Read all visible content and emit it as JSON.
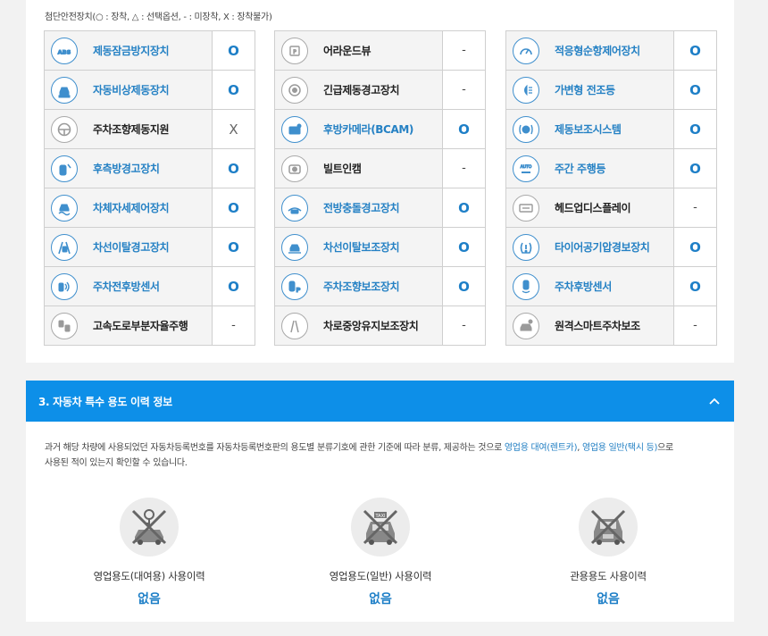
{
  "legend": "첨단안전장치(○ : 장착, △ : 선택옵션, - : 미장착, X : 장착불가)",
  "colors": {
    "accent": "#0d8fe8",
    "installed_text": "#2581c4",
    "icon_on": "#3f8fcd",
    "icon_off": "#a9a9a9"
  },
  "devices": [
    [
      {
        "name": "제동잠금방지장치",
        "status": "O",
        "icon": "abs-icon",
        "active": true
      },
      {
        "name": "자동비상제동장치",
        "status": "O",
        "icon": "emergency-brake-icon",
        "active": true
      },
      {
        "name": "주차조향제동지원",
        "status": "X",
        "icon": "steering-icon",
        "active": false
      },
      {
        "name": "후측방경고장치",
        "status": "O",
        "icon": "rear-side-warning-icon",
        "active": true
      },
      {
        "name": "차체자세제어장치",
        "status": "O",
        "icon": "stability-control-icon",
        "active": true
      },
      {
        "name": "차선이탈경고장치",
        "status": "O",
        "icon": "lane-departure-icon",
        "active": true
      },
      {
        "name": "주차전후방센서",
        "status": "O",
        "icon": "parking-sensor-icon",
        "active": true
      },
      {
        "name": "고속도로부분자율주행",
        "status": "-",
        "icon": "highway-assist-icon",
        "active": false
      }
    ],
    [
      {
        "name": "어라운드뷰",
        "status": "-",
        "icon": "around-view-icon",
        "active": false
      },
      {
        "name": "긴급제동경고장치",
        "status": "-",
        "icon": "brake-warning-icon",
        "active": false
      },
      {
        "name": "후방카메라(BCAM)",
        "status": "O",
        "icon": "rear-camera-icon",
        "active": true
      },
      {
        "name": "빌트인캠",
        "status": "-",
        "icon": "builtin-cam-icon",
        "active": false
      },
      {
        "name": "전방충돌경고장치",
        "status": "O",
        "icon": "forward-collision-icon",
        "active": true
      },
      {
        "name": "차선이탈보조장치",
        "status": "O",
        "icon": "lane-keep-assist-icon",
        "active": true
      },
      {
        "name": "주차조향보조장치",
        "status": "O",
        "icon": "parking-assist-icon",
        "active": true
      },
      {
        "name": "차로중앙유지보조장치",
        "status": "-",
        "icon": "lane-center-icon",
        "active": false
      }
    ],
    [
      {
        "name": "적응형순항제어장치",
        "status": "O",
        "icon": "adaptive-cruise-icon",
        "active": true
      },
      {
        "name": "가변형 전조등",
        "status": "O",
        "icon": "adaptive-headlamp-icon",
        "active": true
      },
      {
        "name": "제동보조시스템",
        "status": "O",
        "icon": "brake-assist-icon",
        "active": true
      },
      {
        "name": "주간 주행등",
        "status": "O",
        "icon": "drl-icon",
        "active": true
      },
      {
        "name": "헤드업디스플레이",
        "status": "-",
        "icon": "hud-icon",
        "active": false
      },
      {
        "name": "타이어공기압경보장치",
        "status": "O",
        "icon": "tpms-icon",
        "active": true
      },
      {
        "name": "주차후방센서",
        "status": "O",
        "icon": "rear-sensor-icon",
        "active": true
      },
      {
        "name": "원격스마트주차보조",
        "status": "-",
        "icon": "remote-parking-icon",
        "active": false
      }
    ]
  ],
  "section3": {
    "title": "3. 자동차 특수 용도 이력 정보",
    "toggle_icon": "chevron-up-icon",
    "desc_part1": "과거 해당 차량에 사용되었던 자동차등록번호를 자동차등록번호판의 용도별 분류기호에 관한 기준에 따라 분류, 제공하는 것으로 ",
    "desc_hl1": "영업용 대여(렌트카)",
    "desc_sep": ", ",
    "desc_hl2": "영업용 일반(택시 등)",
    "desc_part2": "으로",
    "desc_line2": "사용된 적이 있는지 확인할 수 있습니다.",
    "items": [
      {
        "label": "영업용도(대여용) 사용이력",
        "value": "없음",
        "icon": "rental-car-icon"
      },
      {
        "label": "영업용도(일반) 사용이력",
        "value": "없음",
        "icon": "taxi-icon"
      },
      {
        "label": "관용용도 사용이력",
        "value": "없음",
        "icon": "government-car-icon"
      }
    ]
  }
}
